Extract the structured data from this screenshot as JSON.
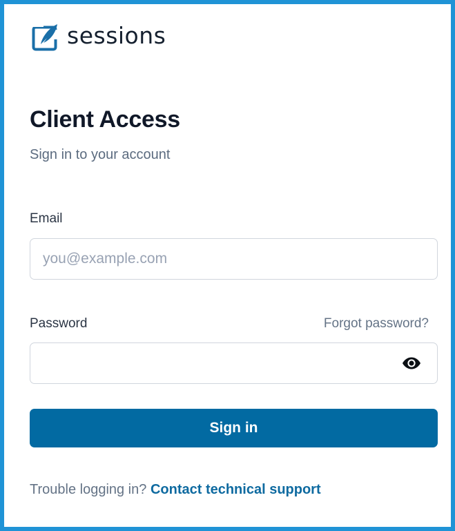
{
  "brand": {
    "name": "sessions",
    "color": "#1a6fa8"
  },
  "header": {
    "title": "Client Access",
    "subtitle": "Sign in to your account"
  },
  "form": {
    "email": {
      "label": "Email",
      "value": "",
      "placeholder": "you@example.com"
    },
    "password": {
      "label": "Password",
      "value": "",
      "placeholder": "",
      "forgot_link": "Forgot password?",
      "toggle_icon": "eye-icon"
    },
    "submit_label": "Sign in"
  },
  "footer": {
    "trouble_text": "Trouble logging in?",
    "support_link": "Contact technical support"
  },
  "colors": {
    "frame_border": "#1f93d6",
    "primary_button": "#026aa2",
    "link": "#0e6aa0"
  }
}
